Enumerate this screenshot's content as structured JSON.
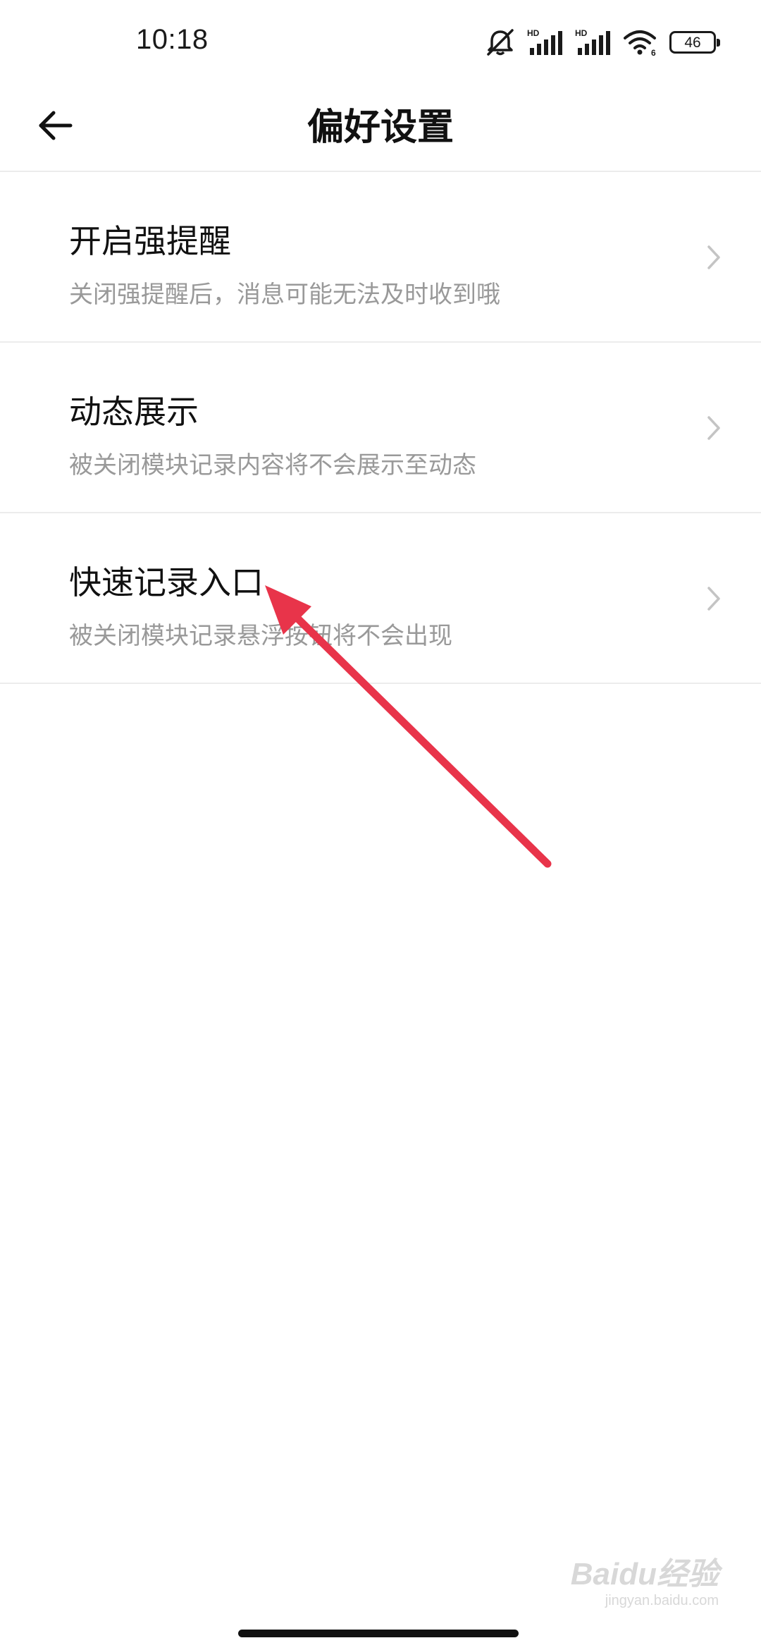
{
  "status_bar": {
    "time": "10:18",
    "battery_level": "46",
    "icons": [
      "mute-bell-icon",
      "hd-signal-icon",
      "hd-signal-icon",
      "wifi-icon",
      "battery-icon"
    ]
  },
  "header": {
    "title": "偏好设置",
    "back_icon": "arrow-left-icon"
  },
  "settings": {
    "items": [
      {
        "title": "开启强提醒",
        "description": "关闭强提醒后，消息可能无法及时收到哦",
        "icon": "chevron-right-icon"
      },
      {
        "title": "动态展示",
        "description": "被关闭模块记录内容将不会展示至动态",
        "icon": "chevron-right-icon"
      },
      {
        "title": "快速记录入口",
        "description": "被关闭模块记录悬浮按钮将不会出现",
        "icon": "chevron-right-icon"
      }
    ]
  },
  "annotation": {
    "color": "#e8344a"
  },
  "watermark": {
    "logo": "Baidu经验",
    "url": "jingyan.baidu.com"
  }
}
